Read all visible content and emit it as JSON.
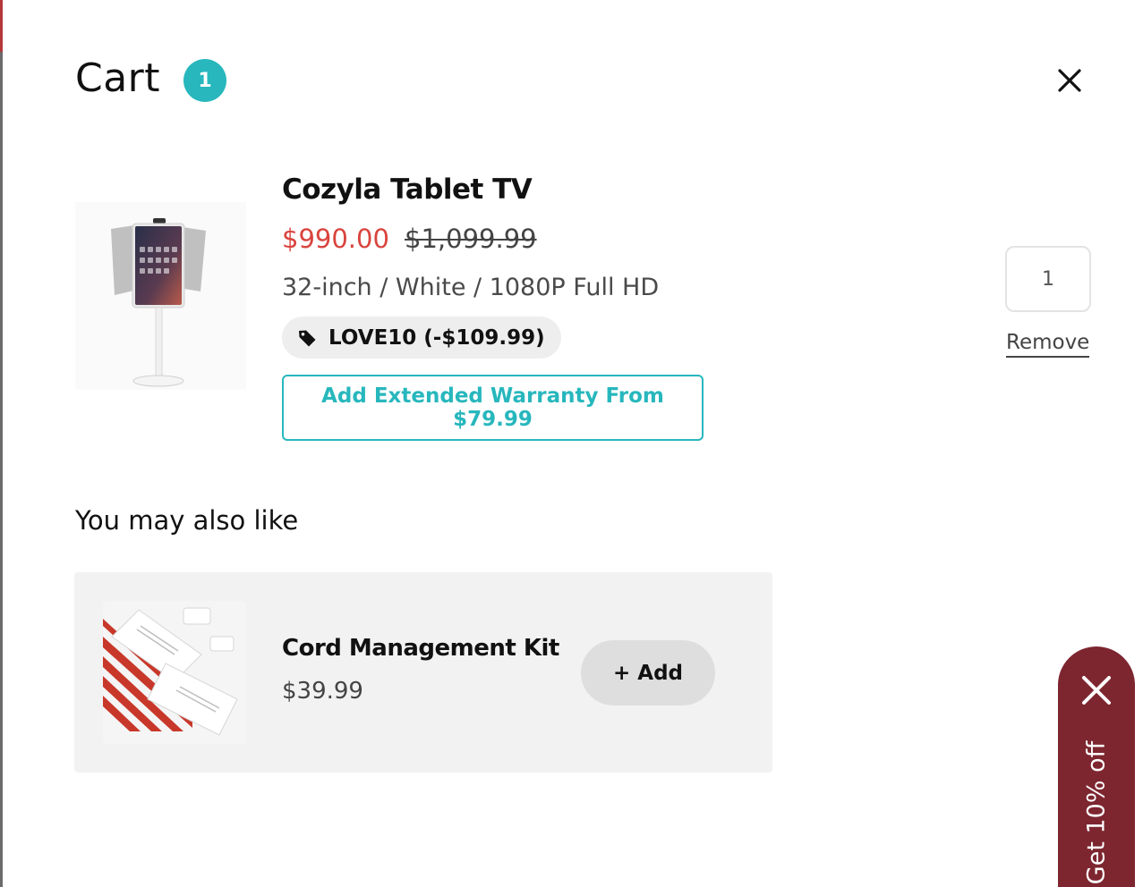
{
  "cart": {
    "title": "Cart",
    "count": "1",
    "close_icon": "close-icon"
  },
  "line_item": {
    "name": "Cozyla Tablet TV",
    "sale_price": "$990.00",
    "original_price": "$1,099.99",
    "variant": "32-inch / White / 1080P Full HD",
    "discount_code": "LOVE10 (-$109.99)",
    "discount_icon": "tag-icon",
    "warranty_button": "Add Extended Warranty From $79.99",
    "quantity": "1",
    "remove_label": "Remove"
  },
  "upsell": {
    "heading": "You may also like",
    "items": [
      {
        "name": "Cord Management Kit",
        "price": "$39.99",
        "add_label": "+ Add"
      }
    ]
  },
  "promo": {
    "label": "Get 10% off",
    "close_icon": "close-icon"
  },
  "colors": {
    "accent": "#27b7bd",
    "sale": "#d9443e",
    "promo_bg": "#7d2630"
  }
}
